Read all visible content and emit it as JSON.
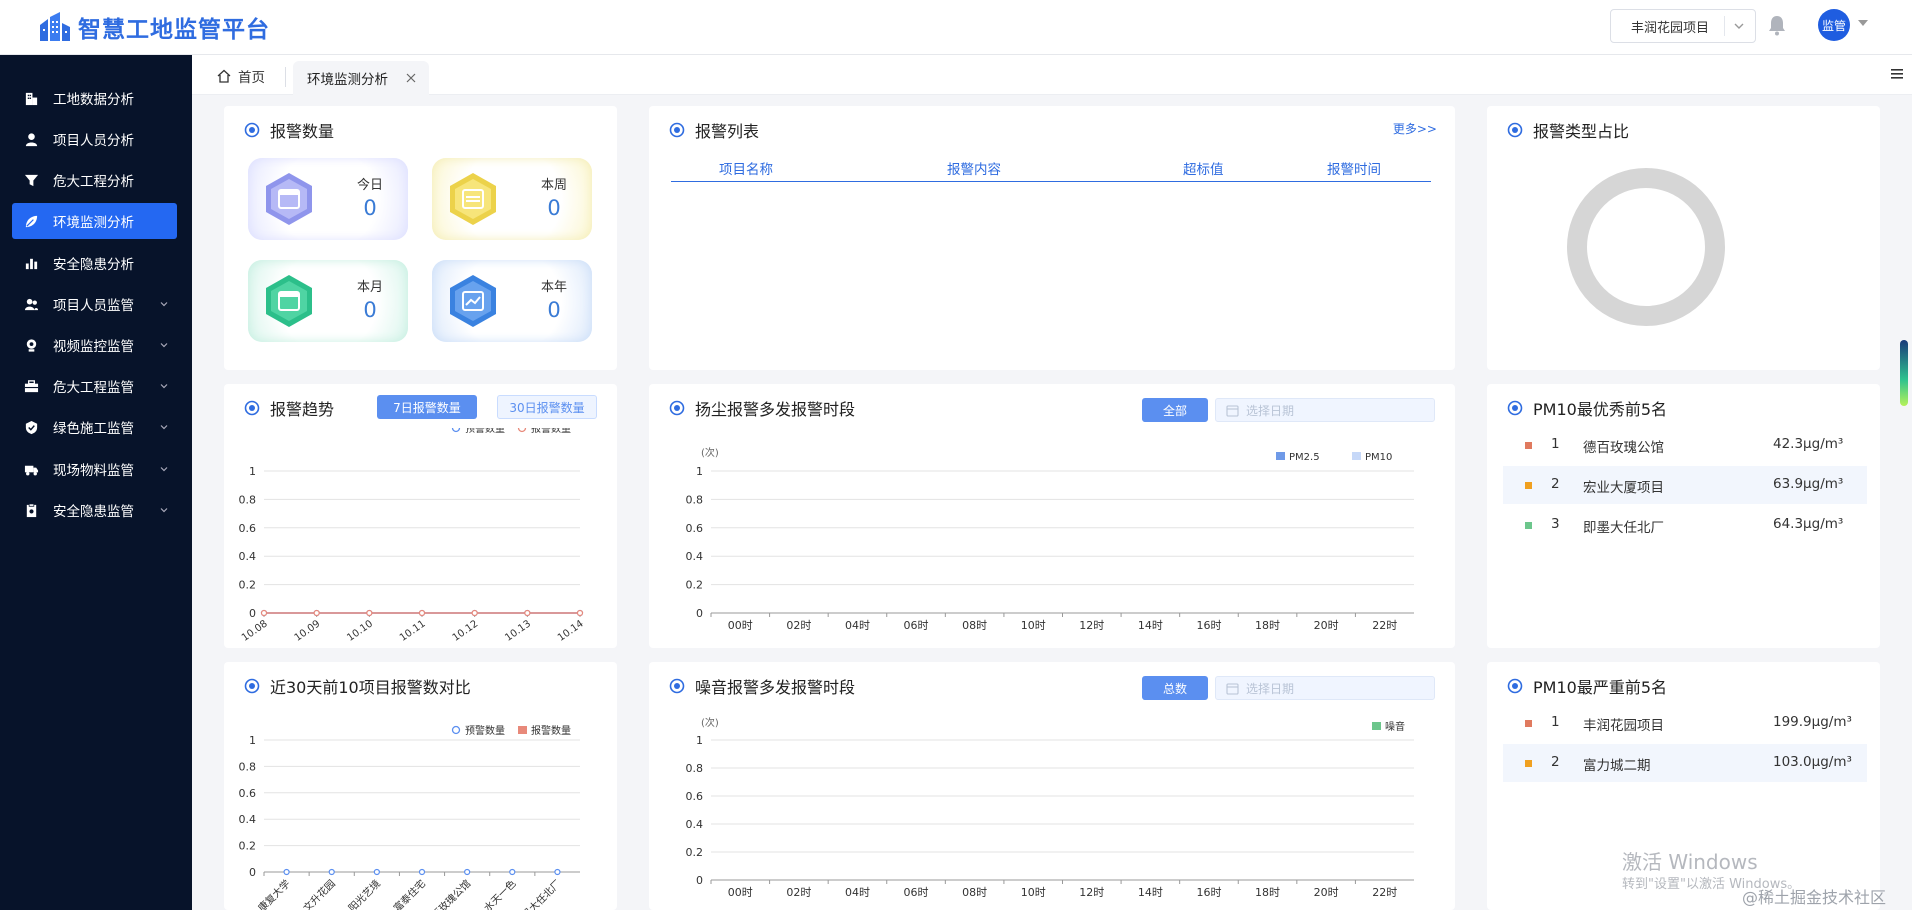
{
  "header": {
    "app_title": "智慧工地监管平台",
    "project_selected": "丰润花园项目",
    "avatar_text": "监管"
  },
  "sidebar": {
    "items": [
      {
        "label": "工地数据分析",
        "icon": "building-icon",
        "has_children": false
      },
      {
        "label": "项目人员分析",
        "icon": "person-icon",
        "has_children": false
      },
      {
        "label": "危大工程分析",
        "icon": "funnel-icon",
        "has_children": false
      },
      {
        "label": "环境监测分析",
        "icon": "leaf-icon",
        "has_children": false,
        "active": true
      },
      {
        "label": "安全隐患分析",
        "icon": "bar-chart-icon",
        "has_children": false
      },
      {
        "label": "项目人员监管",
        "icon": "people-icon",
        "has_children": true
      },
      {
        "label": "视频监控监管",
        "icon": "camera-icon",
        "has_children": true
      },
      {
        "label": "危大工程监管",
        "icon": "toolbox-icon",
        "has_children": true
      },
      {
        "label": "绿色施工监管",
        "icon": "shield-check-icon",
        "has_children": true
      },
      {
        "label": "现场物料监管",
        "icon": "truck-icon",
        "has_children": true
      },
      {
        "label": "安全隐患监管",
        "icon": "clipboard-icon",
        "has_children": true
      }
    ]
  },
  "tabs": {
    "home": "首页",
    "active": "环境监测分析"
  },
  "alarm_count": {
    "title": "报警数量",
    "tiles": [
      {
        "label": "今日",
        "value": "0"
      },
      {
        "label": "本周",
        "value": "0"
      },
      {
        "label": "本月",
        "value": "0"
      },
      {
        "label": "本年",
        "value": "0"
      }
    ]
  },
  "alarm_list": {
    "title": "报警列表",
    "more": "更多>>",
    "columns": [
      "项目名称",
      "报警内容",
      "超标值",
      "报警时间"
    ]
  },
  "alarm_type_ratio": {
    "title": "报警类型占比"
  },
  "alarm_trend": {
    "title": "报警趋势",
    "btn_7d": "7日报警数量",
    "btn_30d": "30日报警数量"
  },
  "dust_card": {
    "title": "扬尘报警多发报警时段",
    "btn_all": "全部",
    "date_placeholder": "选择日期"
  },
  "pm10_best": {
    "title": "PM10最优秀前5名",
    "rows": [
      {
        "rank": "1",
        "name": "德百玫瑰公馆",
        "value": "42.3μg/m³"
      },
      {
        "rank": "2",
        "name": "宏业大厦项目",
        "value": "63.9μg/m³"
      },
      {
        "rank": "3",
        "name": "即墨大任北厂",
        "value": "64.3μg/m³"
      }
    ]
  },
  "compare_card": {
    "title": "近30天前10项目报警数对比"
  },
  "noise_card": {
    "title": "噪音报警多发报警时段",
    "btn_total": "总数",
    "date_placeholder": "选择日期"
  },
  "pm10_worst": {
    "title": "PM10最严重前5名",
    "rows": [
      {
        "rank": "1",
        "name": "丰润花园项目",
        "value": "199.9μg/m³"
      },
      {
        "rank": "2",
        "name": "富力城二期",
        "value": "103.0μg/m³"
      }
    ]
  },
  "watermarks": {
    "win_line1": "激活 Windows",
    "win_line2": "转到\"设置\"以激活 Windows。",
    "site": "@稀土掘金技术社区"
  },
  "colors": {
    "brand": "#2f6ce0",
    "sidebar_bg": "#07132a",
    "active_menu": "#2468f2",
    "rank_dot_1": "#e07a5f",
    "rank_dot_2": "#f0a020",
    "rank_dot_3": "#6cc68c",
    "donut_gray": "#d6d6d6"
  },
  "chart_data": [
    {
      "id": "trend",
      "type": "line",
      "categories": [
        "10.08",
        "10.09",
        "10.10",
        "10.11",
        "10.12",
        "10.13",
        "10.14"
      ],
      "series": [
        {
          "name": "预警数量",
          "values": [
            0,
            0,
            0,
            0,
            0,
            0,
            0
          ],
          "color": "#5b8ff0"
        },
        {
          "name": "报警数量",
          "values": [
            0,
            0,
            0,
            0,
            0,
            0,
            0
          ],
          "color": "#e8897a"
        }
      ],
      "yticks": [
        "0",
        "0.2",
        "0.4",
        "0.6",
        "0.8",
        "1"
      ],
      "ylim": [
        0,
        1
      ],
      "legend": "top-right"
    },
    {
      "id": "dust",
      "type": "bar",
      "ylabel": "(次)",
      "categories": [
        "00时",
        "02时",
        "04时",
        "06时",
        "08时",
        "10时",
        "12时",
        "14时",
        "16时",
        "18时",
        "20时",
        "22时"
      ],
      "series": [
        {
          "name": "PM2.5",
          "values": [
            0,
            0,
            0,
            0,
            0,
            0,
            0,
            0,
            0,
            0,
            0,
            0
          ],
          "color": "#6f9ae8"
        },
        {
          "name": "PM10",
          "values": [
            0,
            0,
            0,
            0,
            0,
            0,
            0,
            0,
            0,
            0,
            0,
            0
          ],
          "color": "#c6d8f8"
        }
      ],
      "yticks": [
        "0",
        "0.2",
        "0.4",
        "0.6",
        "0.8",
        "1"
      ],
      "ylim": [
        0,
        1
      ],
      "legend": "top-right"
    },
    {
      "id": "compare",
      "type": "bar",
      "categories": [
        "康复大学",
        "文升花园",
        "阳光艺境",
        "富泰住宅",
        "德百玫瑰公馆",
        "水天一色",
        "即墨大任北厂"
      ],
      "series": [
        {
          "name": "预警数量",
          "values": [
            0,
            0,
            0,
            0,
            0,
            0,
            0
          ],
          "color": "#5b8ff0"
        },
        {
          "name": "报警数量",
          "values": [
            0,
            0,
            0,
            0,
            0,
            0,
            0
          ],
          "color": "#e8897a"
        }
      ],
      "yticks": [
        "0",
        "0.2",
        "0.4",
        "0.6",
        "0.8",
        "1"
      ],
      "ylim": [
        0,
        1
      ],
      "legend": "top-right"
    },
    {
      "id": "noise",
      "type": "bar",
      "ylabel": "(次)",
      "categories": [
        "00时",
        "02时",
        "04时",
        "06时",
        "08时",
        "10时",
        "12时",
        "14时",
        "16时",
        "18时",
        "20时",
        "22时"
      ],
      "series": [
        {
          "name": "噪音",
          "values": [
            0,
            0,
            0,
            0,
            0,
            0,
            0,
            0,
            0,
            0,
            0,
            0
          ],
          "color": "#6cc68c"
        }
      ],
      "yticks": [
        "0",
        "0.2",
        "0.4",
        "0.6",
        "0.8",
        "1"
      ],
      "ylim": [
        0,
        1
      ],
      "legend": "top-right"
    }
  ]
}
